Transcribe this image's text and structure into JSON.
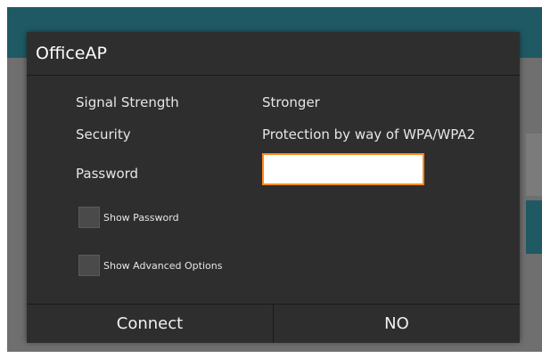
{
  "dialog": {
    "title": "OfficeAP",
    "signal_label": "Signal Strength",
    "signal_value": "Stronger",
    "security_label": "Security",
    "security_value": "Protection by way of WPA/WPA2",
    "password_label": "Password",
    "password_value": "",
    "show_password_label": "Show Password",
    "show_advanced_label": "Show Advanced Options",
    "connect_label": "Connect",
    "cancel_label": "NO"
  },
  "colors": {
    "accent": "#ff8a1f",
    "dialog_bg": "#2e2e2e",
    "app_bar": "#1f5a64"
  }
}
